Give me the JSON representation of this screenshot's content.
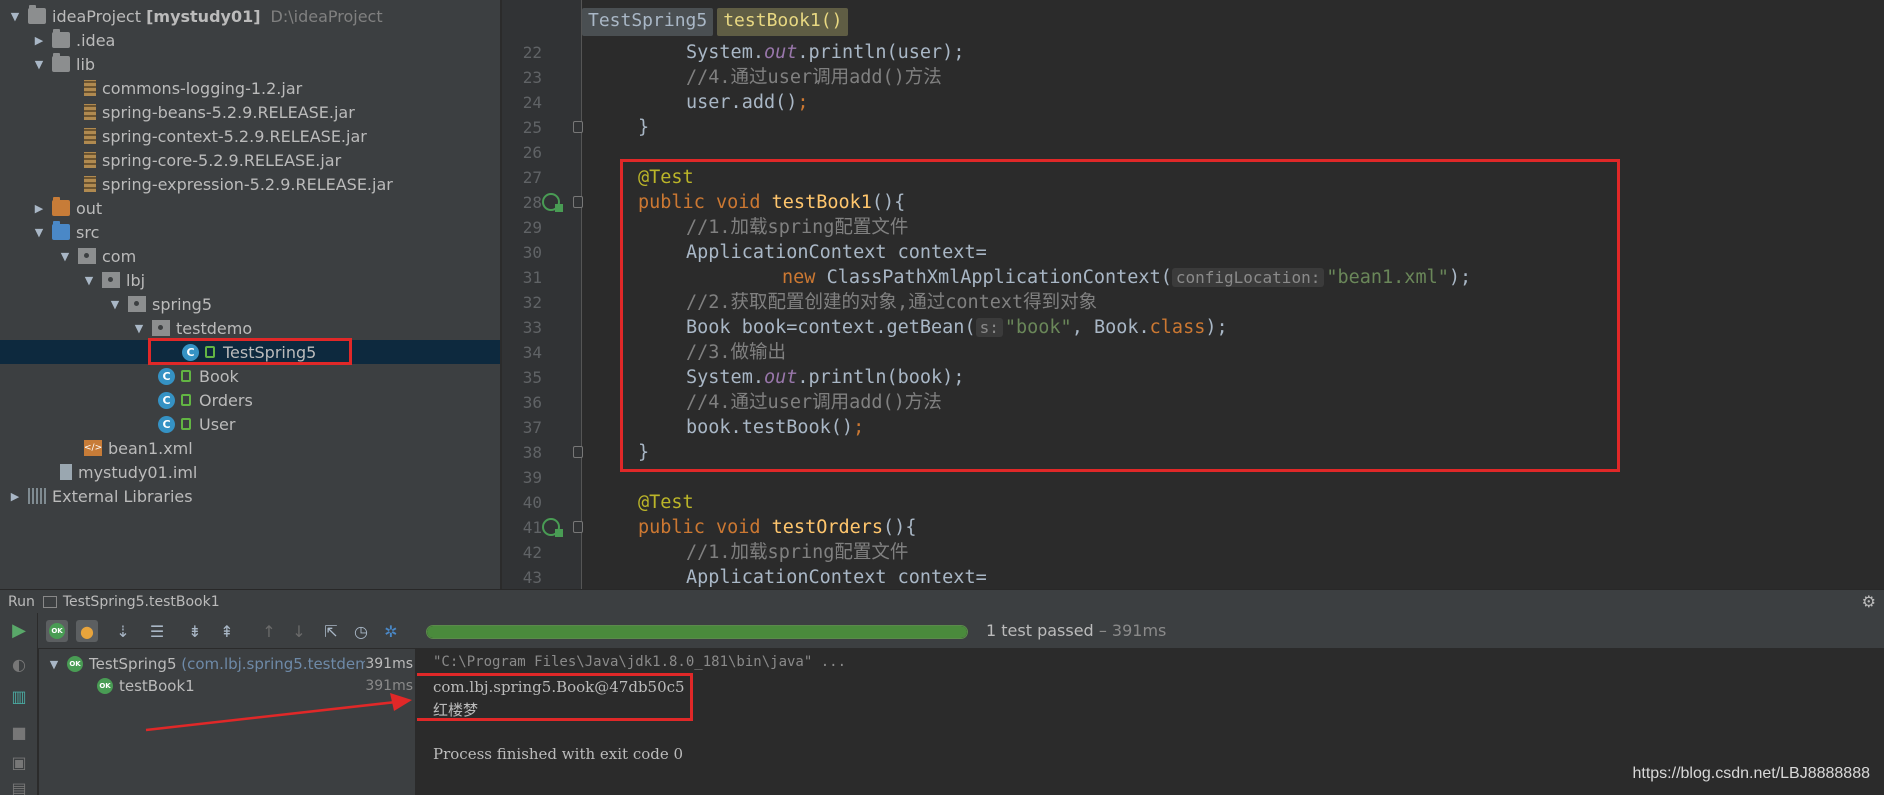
{
  "project_tree": [
    {
      "label": "ideaProject",
      "bold_suffix": "[mystudy01]",
      "path": "D:\\ideaProject",
      "icon": "folder-icon"
    },
    {
      "label": ".idea",
      "icon": "folder-icon"
    },
    {
      "label": "lib",
      "icon": "folder-icon"
    },
    {
      "label": "commons-logging-1.2.jar",
      "icon": "jar-icon"
    },
    {
      "label": "spring-beans-5.2.9.RELEASE.jar",
      "icon": "jar-icon"
    },
    {
      "label": "spring-context-5.2.9.RELEASE.jar",
      "icon": "jar-icon"
    },
    {
      "label": "spring-core-5.2.9.RELEASE.jar",
      "icon": "jar-icon"
    },
    {
      "label": "spring-expression-5.2.9.RELEASE.jar",
      "icon": "jar-icon"
    },
    {
      "label": "out",
      "icon": "folder-icon"
    },
    {
      "label": "src",
      "icon": "source-folder-icon"
    },
    {
      "label": "com",
      "icon": "package-icon"
    },
    {
      "label": "lbj",
      "icon": "package-icon"
    },
    {
      "label": "spring5",
      "icon": "package-icon"
    },
    {
      "label": "testdemo",
      "icon": "package-icon"
    },
    {
      "label": "TestSpring5",
      "icon": "test-class-icon",
      "selected": true
    },
    {
      "label": "Book",
      "icon": "class-icon"
    },
    {
      "label": "Orders",
      "icon": "class-icon"
    },
    {
      "label": "User",
      "icon": "class-icon"
    },
    {
      "label": "bean1.xml",
      "icon": "xml-file-icon"
    },
    {
      "label": "mystudy01.iml",
      "icon": "iml-file-icon"
    },
    {
      "label": "External Libraries",
      "icon": "libraries-icon"
    }
  ],
  "breadcrumbs": [
    "TestSpring5",
    "testBook1()"
  ],
  "line_numbers": [
    "22",
    "23",
    "24",
    "25",
    "26",
    "27",
    "28",
    "29",
    "30",
    "31",
    "32",
    "33",
    "34",
    "35",
    "36",
    "37",
    "38",
    "39",
    "40",
    "41",
    "42",
    "43"
  ],
  "code": {
    "l22": {
      "a": "System.",
      "b": "out",
      "c": ".println(user);"
    },
    "l23": "//4.通过user调用add()方法",
    "l24": {
      "a": "user.add()",
      "b": ";"
    },
    "l25": "}",
    "l27": "@Test",
    "l28": {
      "kw": "public void ",
      "hl": "testBook1",
      "rest": "(){"
    },
    "l29": "//1.加载spring配置文件",
    "l30": "ApplicationContext context=",
    "l31": {
      "kw": "new ",
      "cls": "ClassPathXmlApplicationContext(",
      "hint": "configLocation:",
      "str": "\"bean1.xml\"",
      "end": ");"
    },
    "l32": "//2.获取配置创建的对象,通过context得到对象",
    "l33": {
      "a": "Book book=context.getBean(",
      "hint": "s:",
      "str": "\"book\"",
      "b": ", Book.",
      "kw": "class",
      "c": ");"
    },
    "l34": "//3.做输出",
    "l35": {
      "a": "System.",
      "b": "out",
      "c": ".println(book);"
    },
    "l36": "//4.通过user调用add()方法",
    "l37": {
      "a": "book.testBook()",
      "b": ";"
    },
    "l38": "}",
    "l40": "@Test",
    "l41": {
      "kw": "public void ",
      "name": "testOrders",
      "rest": "(){"
    },
    "l42": "//1.加载spring配置文件",
    "l43": "ApplicationContext context="
  },
  "run": {
    "tab_label": "Run",
    "config_name": "TestSpring5.testBook1",
    "status_text": "1 test passed",
    "duration_text": "– 391ms",
    "progress": 1.0,
    "test_tree": [
      {
        "label": "TestSpring5",
        "detail": "(com.lbj.spring5.testdem",
        "time": "391ms"
      },
      {
        "label": "testBook1",
        "time": "391ms"
      }
    ],
    "console": [
      "\"C:\\Program Files\\Java\\jdk1.8.0_181\\bin\\java\" ...",
      "com.lbj.spring5.Book@47db50c5",
      "红楼梦",
      "Process finished with exit code 0"
    ]
  },
  "watermark": "https://blog.csdn.net/LBJ8888888",
  "colors": {
    "keyword": "#cc7832",
    "annotation": "#bbb529",
    "string": "#6a8759",
    "comment": "#808080",
    "highlight_box": "#e02828",
    "pass_green": "#499c54"
  }
}
